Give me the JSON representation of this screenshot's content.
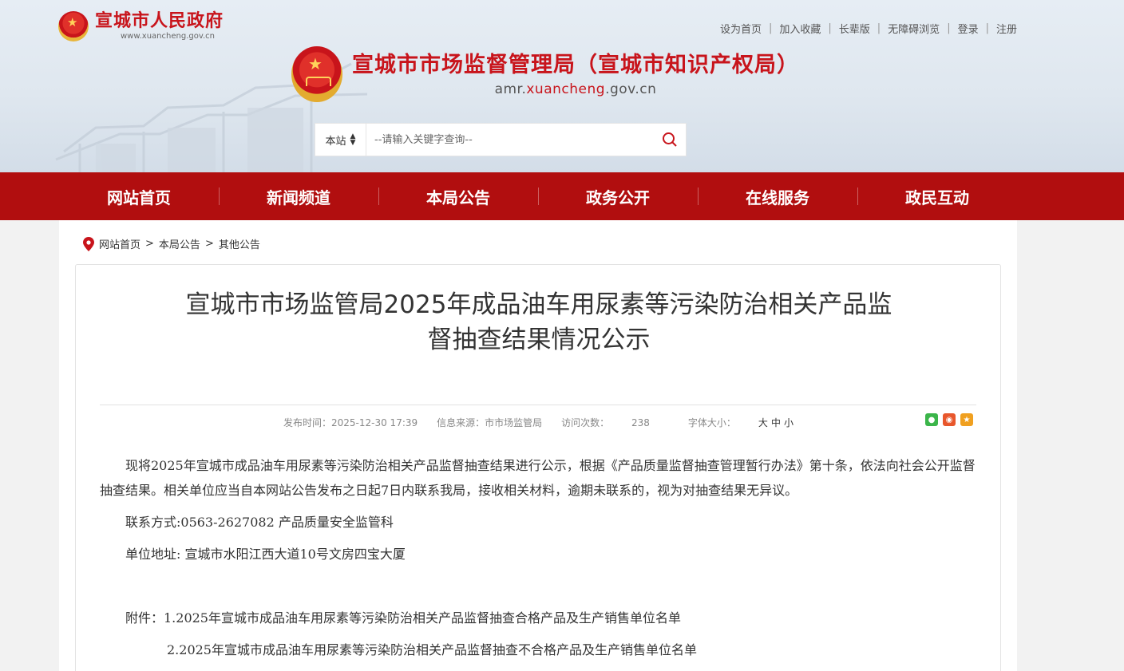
{
  "header": {
    "gov_name": "宣城市人民政府",
    "gov_url": "www.xuancheng.gov.cn",
    "top_links": [
      "设为首页",
      "加入收藏",
      "长辈版",
      "无障碍浏览",
      "登录",
      "注册"
    ],
    "site_name": "宣城市市场监督管理局（宣城市知识产权局）",
    "site_domain_prefix": "amr.",
    "site_domain_highlight": "xuancheng",
    "site_domain_suffix": ".gov.cn"
  },
  "search": {
    "scope": "本站",
    "placeholder": "--请输入关键字查询--"
  },
  "nav": [
    "网站首页",
    "新闻频道",
    "本局公告",
    "政务公开",
    "在线服务",
    "政民互动"
  ],
  "breadcrumb": [
    "网站首页",
    "本局公告",
    "其他公告"
  ],
  "article": {
    "title_line1": "宣城市市场监管局2025年成品油车用尿素等污染防治相关产品监",
    "title_line2": "督抽查结果情况公示",
    "meta": {
      "publish": "发布时间：2025-12-30 17:39",
      "source": "信息来源：市市场监管局",
      "views_label": "访问次数：",
      "views": "238",
      "font_label": "字体大小：",
      "font_large": "大",
      "font_medium": "中",
      "font_small": "小"
    },
    "paragraphs": {
      "p1": "现将2025年宣城市成品油车用尿素等污染防治相关产品监督抽查结果进行公示，根据《产品质量监督抽查管理暂行办法》第十条，依法向社会公开监督抽查结果。相关单位应当自本网站公告发布之日起7日内联系我局，接收相关材料，逾期未联系的，视为对抽查结果无异议。",
      "contact": "联系方式:0563-2627082 产品质量安全监管科",
      "address": "单位地址: 宣城市水阳江西大道10号文房四宝大厦",
      "attach1": "附件：1.2025年宣城市成品油车用尿素等污染防治相关产品监督抽查合格产品及生产销售单位名单",
      "attach2": "2.2025年宣城市成品油车用尿素等污染防治相关产品监督抽查不合格产品及生产销售单位名单"
    }
  },
  "colors": {
    "brand_red": "#c8141b",
    "nav_red": "#b10e0f"
  }
}
